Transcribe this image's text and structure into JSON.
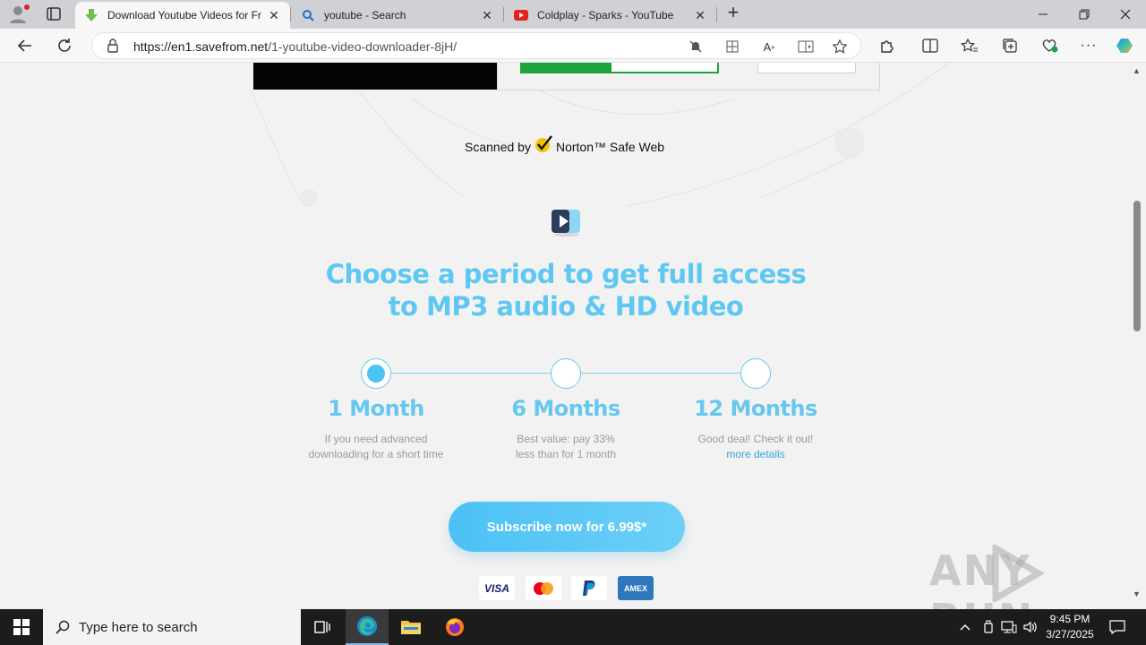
{
  "browser": {
    "tabs": [
      {
        "title": "Download Youtube Videos for Fre",
        "active": true,
        "favicon": "green-download-arrow-icon"
      },
      {
        "title": "youtube - Search",
        "active": false,
        "favicon": "search-icon"
      },
      {
        "title": "Coldplay - Sparks - YouTube",
        "active": false,
        "favicon": "youtube-icon"
      }
    ],
    "url_host": "https://en1.savefrom.net",
    "url_path": "/1-youtube-video-downloader-8jH/"
  },
  "page": {
    "norton_prefix": "Scanned by",
    "norton_brand": "Norton™ Safe Web",
    "headline_line1": "Choose a period to get full access",
    "headline_line2": "to MP3 audio & HD video",
    "plans": [
      {
        "name": "1 Month",
        "desc_line1": "If you need advanced",
        "desc_line2": "downloading for a short time",
        "selected": true
      },
      {
        "name": "6 Months",
        "desc_line1": "Best value: pay 33%",
        "desc_line2": "less than for 1 month",
        "selected": false
      },
      {
        "name": "12 Months",
        "desc_line1": "Good deal! Check it out!",
        "link": "more details",
        "selected": false
      }
    ],
    "subscribe_label": "Subscribe now for 6.99$*",
    "payment_methods": [
      "VISA",
      "Mastercard",
      "PayPal",
      "AMEX"
    ],
    "watermark": "ANY RUN",
    "accent_color": "#5ec8f2",
    "button_color": "#4cc1f5"
  },
  "taskbar": {
    "search_placeholder": "Type here to search",
    "time": "9:45 PM",
    "date": "3/27/2025"
  }
}
